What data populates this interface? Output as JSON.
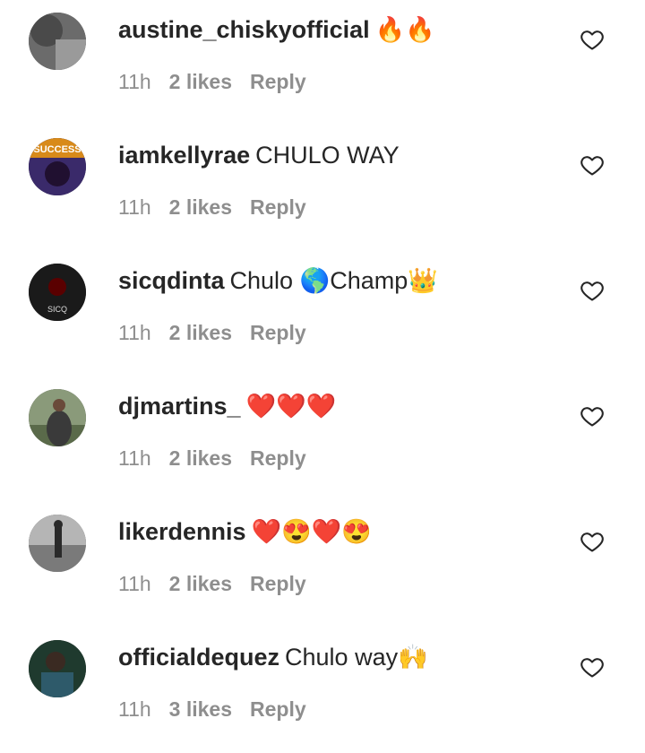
{
  "comments": [
    {
      "username": "austine_chiskyofficial",
      "text": "🔥🔥",
      "time": "11h",
      "likes": "2 likes",
      "reply": "Reply",
      "avatar_color": "#5a5a5a"
    },
    {
      "username": "iamkellyrae",
      "text": "CHULO WAY",
      "time": "11h",
      "likes": "2 likes",
      "reply": "Reply",
      "avatar_color": "#3a2a6a",
      "avatar_text": "SUCCESS"
    },
    {
      "username": "sicqdinta",
      "text": "Chulo 🌎Champ👑",
      "time": "11h",
      "likes": "2 likes",
      "reply": "Reply",
      "avatar_color": "#1a1a1a",
      "avatar_text": "SICQ"
    },
    {
      "username": "djmartins_",
      "text": "❤️❤️❤️",
      "time": "11h",
      "likes": "2 likes",
      "reply": "Reply",
      "avatar_color": "#7a8a6a"
    },
    {
      "username": "likerdennis",
      "text": "❤️😍❤️😍",
      "time": "11h",
      "likes": "2 likes",
      "reply": "Reply",
      "avatar_color": "#9a9a9a"
    },
    {
      "username": "officialdequez",
      "text": "Chulo way🙌",
      "time": "11h",
      "likes": "3 likes",
      "reply": "Reply",
      "avatar_color": "#2a4a3a"
    }
  ],
  "icons": {
    "like": "heart-outline-icon"
  },
  "colors": {
    "text": "#262626",
    "meta": "#8e8e8e",
    "background": "#ffffff"
  }
}
